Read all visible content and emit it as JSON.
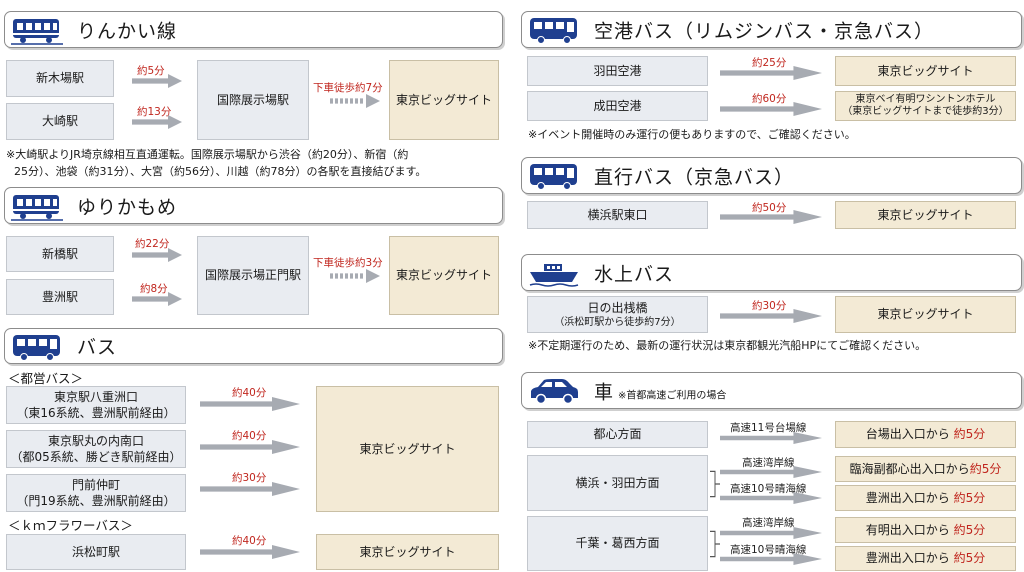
{
  "colors": {
    "accent": "#c0261e",
    "box": "#e9ecf1",
    "dest": "#f3ead5",
    "arrow": "#a7abb2"
  },
  "rinkai": {
    "title": "りんかい線",
    "icon": "train-icon",
    "from1": "新木場駅",
    "time1": "約5分",
    "from2": "大崎駅",
    "time2": "約13分",
    "hub": "国際展示場駅",
    "walk": "下車徒歩約7分",
    "dest": "東京ビッグサイト",
    "note1": "※大崎駅よりJR埼京線相互直通運転。国際展示場駅から渋谷（約20分）、新宿（約",
    "note2": "25分）、池袋（約31分）、大宮（約56分）、川越（約78分）の各駅を直接結びます。"
  },
  "yurikamome": {
    "title": "ゆりかもめ",
    "icon": "train-icon",
    "from1": "新橋駅",
    "time1": "約22分",
    "from2": "豊洲駅",
    "time2": "約8分",
    "hub": "国際展示場正門駅",
    "walk": "下車徒歩約3分",
    "dest": "東京ビッグサイト"
  },
  "bus": {
    "title": "バス",
    "icon": "bus-icon",
    "toei": "＜都営バス＞",
    "r1a": "東京駅八重洲口",
    "r1b": "（東16系統、豊洲駅前経由）",
    "t1": "約40分",
    "r2a": "東京駅丸の内南口",
    "r2b": "（都05系統、勝どき駅前経由）",
    "t2": "約40分",
    "r3a": "門前仲町",
    "r3b": "（門19系統、豊洲駅前経由）",
    "t3": "約30分",
    "dest": "東京ビッグサイト",
    "km": "＜ｋｍフラワーバス＞",
    "r4": "浜松町駅",
    "t4": "約40分",
    "dest2": "東京ビッグサイト"
  },
  "airport": {
    "title": "空港バス（リムジンバス・京急バス）",
    "icon": "bus-icon",
    "from1": "羽田空港",
    "time1": "約25分",
    "dest1": "東京ビッグサイト",
    "from2": "成田空港",
    "time2": "約60分",
    "dest2a": "東京ベイ有明ワシントンホテル",
    "dest2b": "（東京ビッグサイトまで徒歩約3分）",
    "note": "※イベント開催時のみ運行の便もありますので、ご確認ください。"
  },
  "direct": {
    "title": "直行バス（京急バス）",
    "icon": "bus-icon",
    "from": "横浜駅東口",
    "time": "約50分",
    "dest": "東京ビッグサイト"
  },
  "water": {
    "title": "水上バス",
    "icon": "ship-icon",
    "froma": "日の出桟橋",
    "fromb": "（浜松町駅から徒歩約7分）",
    "time": "約30分",
    "dest": "東京ビッグサイト",
    "note": "※不定期運行のため、最新の運行状況は東京都観光汽船HPにてご確認ください。"
  },
  "car": {
    "title": "車",
    "note": "※首都高速ご利用の場合",
    "icon": "car-icon",
    "f1": "都心方面",
    "f1r": "高速11号台場線",
    "d1": "台場出入口から",
    "d1t": "約5分",
    "f2": "横浜・羽田方面",
    "f2r1": "高速湾岸線",
    "d2a": "臨海副都心出入口から",
    "d2at": "約5分",
    "f2r2": "高速10号晴海線",
    "d2b": "豊洲出入口から",
    "d2bt": "約5分",
    "f3": "千葉・葛西方面",
    "f3r1": "高速湾岸線",
    "d3a": "有明出入口から",
    "d3at": "約5分",
    "f3r2": "高速10号晴海線",
    "d3b": "豊洲出入口から",
    "d3bt": "約5分"
  }
}
